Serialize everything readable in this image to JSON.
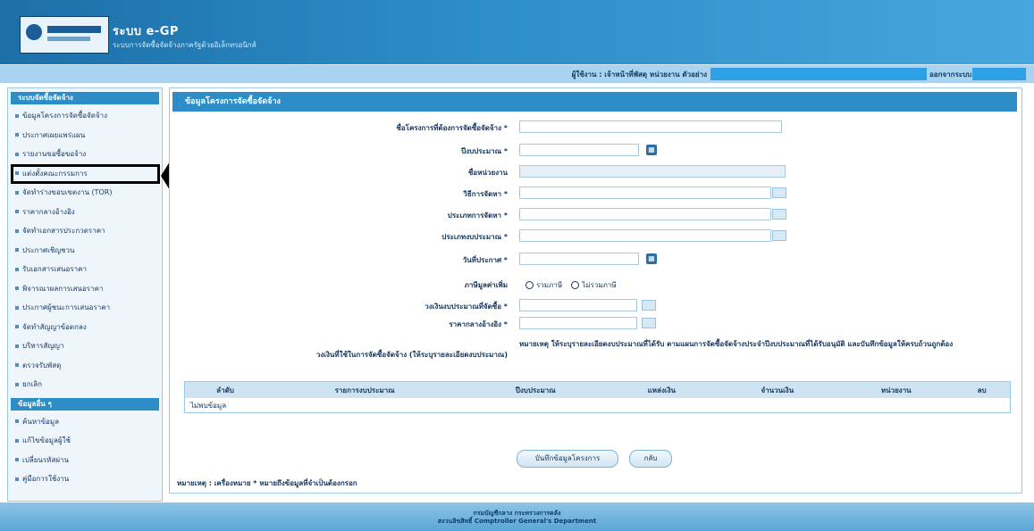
{
  "header": {
    "title": "ระบบ e-GP",
    "subtitle": "ระบบการจัดซื้อจัดจ้างภาครัฐด้วยอิเล็กทรอนิกส์"
  },
  "statusbar": {
    "user_text": "ผู้ใช้งาน : เจ้าหน้าที่พัสดุ หน่วยงาน ตัวอย่าง",
    "logout": "ออกจากระบบ"
  },
  "sidebar": {
    "section1_title": "ระบบจัดซื้อจัดจ้าง",
    "items1": [
      {
        "label": "ข้อมูลโครงการจัดซื้อจัดจ้าง"
      },
      {
        "label": "ประกาศเผยแพร่แผน"
      },
      {
        "label": "รายงานขอซื้อขอจ้าง"
      },
      {
        "label": "แต่งตั้งคณะกรรมการ"
      },
      {
        "label": "จัดทำร่างขอบเขตงาน (TOR)"
      },
      {
        "label": "ราคากลางอ้างอิง"
      },
      {
        "label": "จัดทำเอกสารประกวดราคา"
      },
      {
        "label": "ประกาศเชิญชวน"
      },
      {
        "label": "รับเอกสารเสนอราคา"
      },
      {
        "label": "พิจารณาผลการเสนอราคา"
      },
      {
        "label": "ประกาศผู้ชนะการเสนอราคา"
      },
      {
        "label": "จัดทำสัญญาข้อตกลง"
      },
      {
        "label": "บริหารสัญญา"
      },
      {
        "label": "ตรวจรับพัสดุ"
      },
      {
        "label": "ยกเลิก"
      }
    ],
    "section2_title": "ข้อมูลอื่น ๆ",
    "items2": [
      {
        "label": "ค้นหาข้อมูล"
      },
      {
        "label": "แก้ไขข้อมูลผู้ใช้"
      },
      {
        "label": "เปลี่ยนรหัสผ่าน"
      },
      {
        "label": "คู่มือการใช้งาน"
      }
    ]
  },
  "main": {
    "section_title": "ข้อมูลโครงการจัดซื้อจัดจ้าง",
    "fields": [
      {
        "label": "ชื่อโครงการที่ต้องการจัดซื้อจัดจ้าง *",
        "value": ""
      },
      {
        "label": "ปีงบประมาณ *",
        "value": ""
      },
      {
        "label": "ชื่อหน่วยงาน",
        "value": ""
      },
      {
        "label": "วิธีการจัดหา *",
        "value": ""
      },
      {
        "label": "ประเภทการจัดหา *",
        "value": ""
      },
      {
        "label": "ประเภทงบประมาณ *",
        "value": ""
      },
      {
        "label": "วันที่ประกาศ *",
        "value": ""
      },
      {
        "label": "ภาษีมูลค่าเพิ่ม",
        "option_a": "รวมภาษี",
        "option_b": "ไม่รวมภาษี"
      },
      {
        "label": "วงเงินงบประมาณที่จัดซื้อ *",
        "value": ""
      },
      {
        "label": "ราคากลางอ้างอิง *",
        "value": ""
      }
    ],
    "note_label": "วงเงินที่ใช้ในการจัดซื้อจัดจ้าง (ให้ระบุรายละเอียดงบประมาณ)",
    "note_text": "หมายเหตุ ให้ระบุรายละเอียดงบประมาณที่ได้รับ ตามแผนการจัดซื้อจัดจ้างประจำปีงบประมาณที่ได้รับอนุมัติ และบันทึกข้อมูลให้ครบถ้วนถูกต้อง"
  },
  "table": {
    "headers": [
      "ลำดับ",
      "รายการงบประมาณ",
      "ปีงบประมาณ",
      "แหล่งเงิน",
      "จำนวนเงิน",
      "หน่วยงาน",
      "ลบ"
    ],
    "empty_text": "ไม่พบข้อมูล"
  },
  "buttons": {
    "save": "บันทึกข้อมูลโครงการ",
    "back": "กลับ"
  },
  "footer_note": "หมายเหตุ : เครื่องหมาย * หมายถึงข้อมูลที่จำเป็นต้องกรอก",
  "copyright": {
    "line1": "กรมบัญชีกลาง กระทรวงการคลัง",
    "line2": "สงวนลิขสิทธิ์ Comptroller General's Department"
  },
  "colors": {
    "header_blue": "#2c8dc7",
    "accent_blue": "#2ea0e6"
  }
}
